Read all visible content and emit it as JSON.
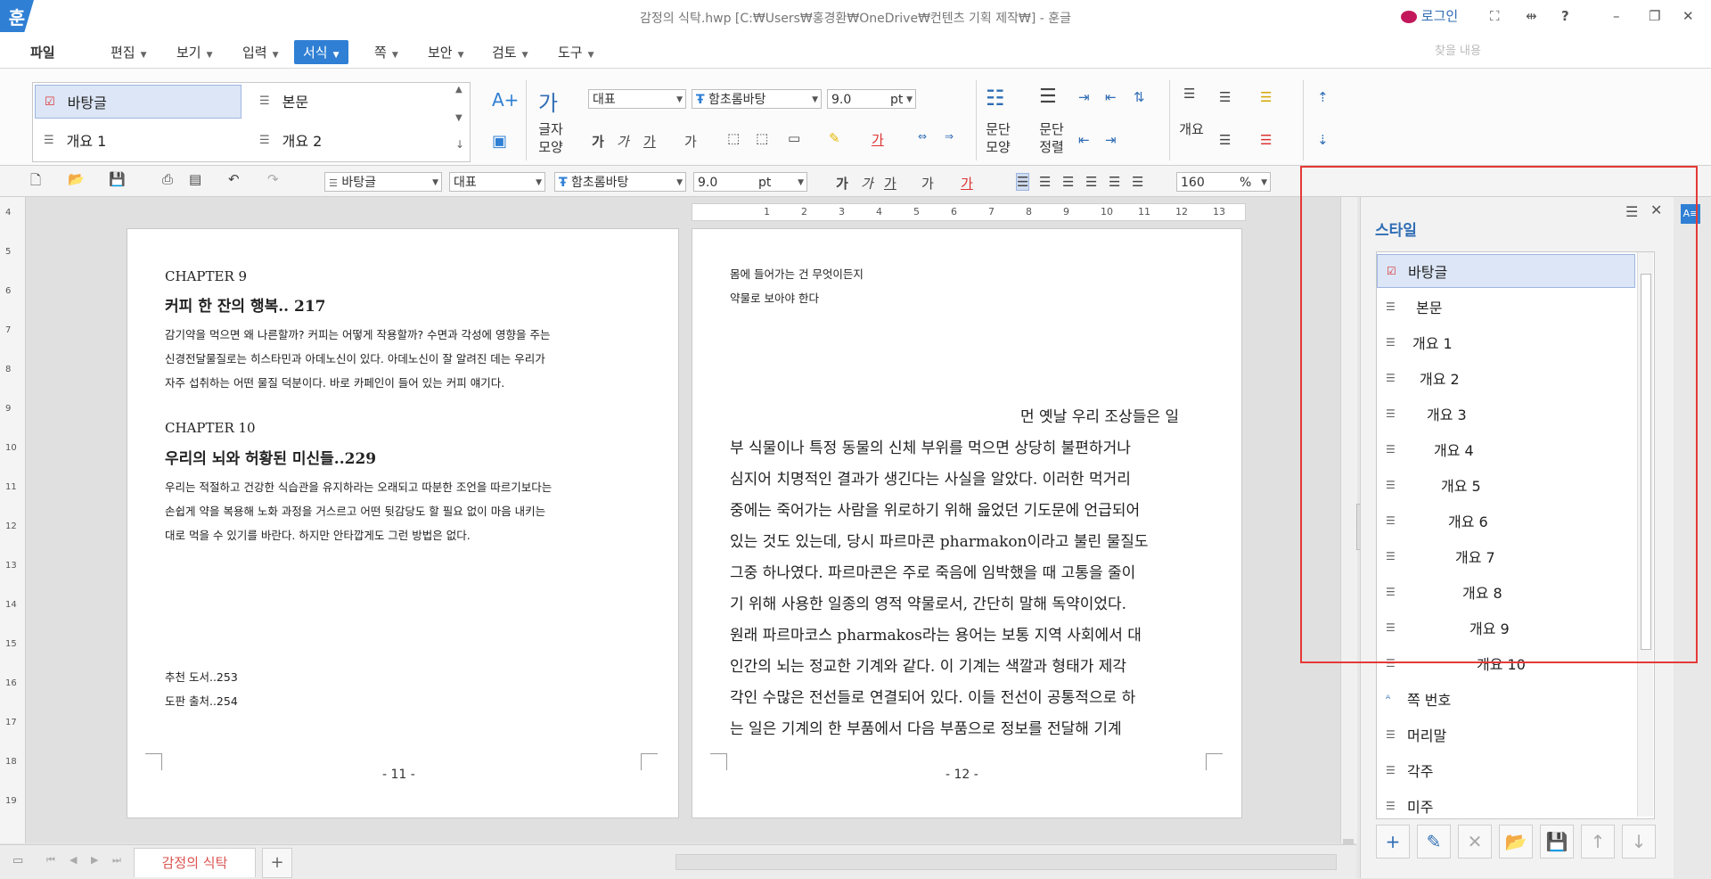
{
  "titlebar": {
    "app_icon": "훈",
    "title": "감정의 식탁.hwp [C:₩Users₩홍경환₩OneDrive₩컨텐츠 기획 제작₩] - 훈글",
    "login": "로그인",
    "help": "?"
  },
  "menu": {
    "file": "파일",
    "items": [
      "편집",
      "보기",
      "입력",
      "서식",
      "쪽",
      "보안",
      "검토",
      "도구"
    ],
    "active": "서식",
    "search_placeholder": "찾을 내용"
  },
  "ribbon": {
    "gallery": [
      "바탕글",
      "본문",
      "개요 1",
      "개요 2"
    ],
    "char_shape": "글자 모양",
    "para_shape": "문단 모양",
    "para_align": "문단 정렬",
    "outline": "개요",
    "lang": "대표",
    "font": "함초롬바탕",
    "size": "9.0",
    "unit": "pt"
  },
  "toolbar": {
    "style": "바탕글",
    "lang": "대표",
    "font": "함초롬바탕",
    "size": "9.0",
    "unit": "pt",
    "zoom": "160",
    "zoom_unit": "%"
  },
  "vruler_marks": [
    "4",
    "5",
    "6",
    "7",
    "8",
    "9",
    "10",
    "11",
    "12",
    "13",
    "14",
    "15",
    "16",
    "17",
    "18",
    "19"
  ],
  "hruler_marks": [
    "1",
    "2",
    "3",
    "4",
    "5",
    "6",
    "7",
    "8",
    "9",
    "10",
    "11",
    "12",
    "13"
  ],
  "page_left": {
    "ch9_label": "CHAPTER 9",
    "ch9_title": "커피 한 잔의 행복.. 217",
    "ch9_body": [
      "감기약을 먹으면 왜 나른할까? 커피는 어떻게 작용할까? 수면과 각성에 영향을 주는",
      "신경전달물질로는 히스타민과 아데노신이 있다. 아데노신이 잘 알려진 데는 우리가",
      "자주 섭취하는 어떤 물질 덕분이다. 바로 카페인이 들어 있는 커피 얘기다."
    ],
    "ch10_label": "CHAPTER 10",
    "ch10_title": "우리의 뇌와 허황된 미신들..229",
    "ch10_body": [
      "우리는 적절하고 건강한 식습관을 유지하라는 오래되고 따분한 조언을 따르기보다는",
      "손쉽게 약을 복용해 노화 과정을 거스르고 어떤 뒷감당도 할 필요 없이 마음 내키는",
      "대로 먹을 수 있기를 바란다. 하지만 안타깝게도 그런 방법은 없다."
    ],
    "refs": [
      "추천 도서..253",
      "도판 출처..254"
    ],
    "page_num": "- 11 -"
  },
  "page_right": {
    "top": [
      "몸에 들어가는 건 무엇이든지",
      "약물로 보아야 한다"
    ],
    "body": [
      "먼 옛날 우리 조상들은 일",
      "부 식물이나 특정 동물의 신체 부위를 먹으면 상당히 불편하거나",
      "심지어 치명적인 결과가 생긴다는 사실을 알았다. 이러한 먹거리",
      "중에는 죽어가는 사람을 위로하기 위해 읊었던 기도문에 언급되어",
      "있는 것도 있는데, 당시 파르마콘 pharmakon이라고 불린 물질도",
      "그중 하나였다. 파르마콘은 주로 죽음에 임박했을 때 고통을 줄이",
      "기 위해 사용한 일종의 영적 약물로서, 간단히 말해 독약이었다.",
      "원래 파르마코스 pharmakos라는 용어는 보통 지역 사회에서 대",
      "인간의 뇌는 정교한 기계와 같다. 이 기계는 색깔과 형태가 제각",
      "각인 수많은 전선들로 연결되어 있다. 이들 전선이 공통적으로 하",
      "는 일은 기계의 한 부품에서 다음 부품으로 정보를 전달해 기계"
    ],
    "page_num": "- 12 -"
  },
  "bottom": {
    "doc_tab": "감정의 식탁",
    "add_tab": "+"
  },
  "style_panel": {
    "title": "스타일",
    "items": [
      "바탕글",
      "본문",
      "개요 1",
      "개요 2",
      "개요 3",
      "개요 4",
      "개요 5",
      "개요 6",
      "개요 7",
      "개요 8",
      "개요 9",
      "개요 10",
      "쪽 번호",
      "머리말",
      "각주",
      "미주"
    ],
    "selected": "바탕글"
  },
  "colors": {
    "accent": "#2f7fd4",
    "highlight_box": "#e53935",
    "doc_tab_text": "#d9534f"
  }
}
